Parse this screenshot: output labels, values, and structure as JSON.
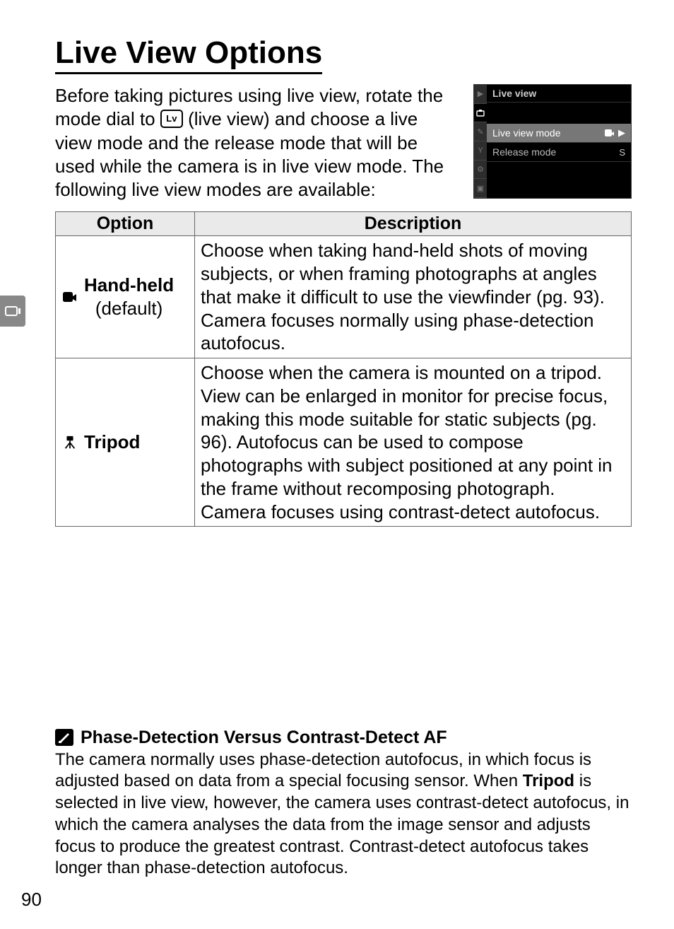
{
  "title": "Live View Options",
  "intro_before_icon": "Before taking pictures using live view, rotate the mode dial to ",
  "intro_icon_label": "Lv",
  "intro_after_icon": " (live view) and choose a live view mode and the release mode that will be used while the camera is in live view mode.  The following live view modes are available:",
  "menu": {
    "title": "Live view",
    "rows": [
      {
        "label": "Live view mode",
        "value_icon": "hand",
        "arrow": true,
        "selected": true
      },
      {
        "label": "Release mode",
        "value_text": "S",
        "selected": false
      }
    ]
  },
  "table": {
    "headers": [
      "Option",
      "Description"
    ],
    "rows": [
      {
        "icon": "hand",
        "label": "Hand-held",
        "sublabel": "(default)",
        "description": "Choose when taking hand-held shots of moving subjects, or when framing photographs at angles that make it difficult to use the viewfinder (pg. 93).  Camera focuses normally using phase-detection autofocus."
      },
      {
        "icon": "tripod",
        "label": "Tripod",
        "sublabel": "",
        "description": "Choose when the camera is mounted on a tripod.  View can be enlarged in monitor for precise focus, making this mode suitable for static subjects (pg. 96).  Autofocus can be used to compose photographs with subject positioned at any point in the frame without recomposing photograph.  Camera focuses using contrast-detect autofocus."
      }
    ]
  },
  "note": {
    "title": "Phase-Detection Versus Contrast-Detect AF",
    "body_before_bold": "The camera normally uses phase-detection autofocus, in which focus is adjusted based on data from a special focusing sensor.  When ",
    "bold_word": "Tripod",
    "body_after_bold": " is selected in live view, however, the camera uses contrast-detect autofocus, in which the camera analyses the data from the image sensor and adjusts focus to produce the greatest contrast.  Contrast-detect autofocus takes longer than phase-detection autofocus."
  },
  "page_number": "90"
}
